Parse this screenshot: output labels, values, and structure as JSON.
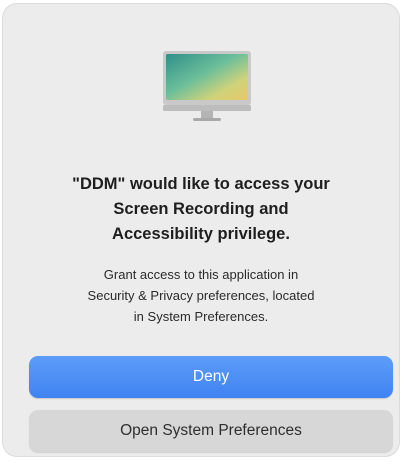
{
  "dialog": {
    "icon": "monitor-icon",
    "title": "\"DDM\" would like to access your\nScreen Recording and\nAccessibility privilege.",
    "message": "Grant access to this application in\nSecurity & Privacy preferences, located\nin System Preferences.",
    "buttons": {
      "deny_label": "Deny",
      "open_label": "Open System Preferences"
    }
  },
  "colors": {
    "accent": "#4a8ef5",
    "dialog_bg": "#ececec",
    "secondary_button": "#d7d7d7"
  }
}
